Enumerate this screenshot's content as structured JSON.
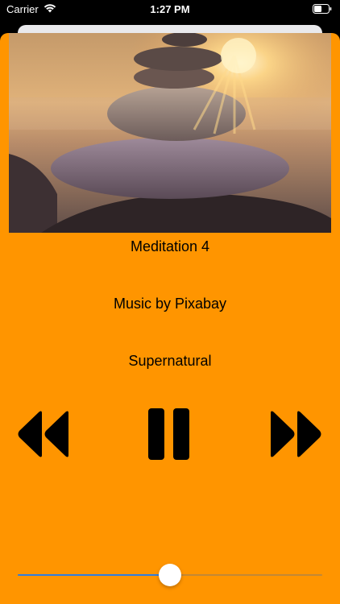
{
  "status_bar": {
    "carrier": "Carrier",
    "time": "1:27 PM"
  },
  "player": {
    "track_title": "Meditation 4",
    "credit": "Music by Pixabay",
    "album": "Supernatural",
    "progress_fraction": 0.5,
    "is_playing": true
  },
  "icons": {
    "wifi": "wifi-icon",
    "battery": "battery-icon",
    "rewind": "rewind-icon",
    "pause": "pause-icon",
    "forward": "fast-forward-icon"
  },
  "colors": {
    "panel_bg": "#ff9500",
    "slider_fill": "#2f7de1",
    "controls": "#000000"
  }
}
